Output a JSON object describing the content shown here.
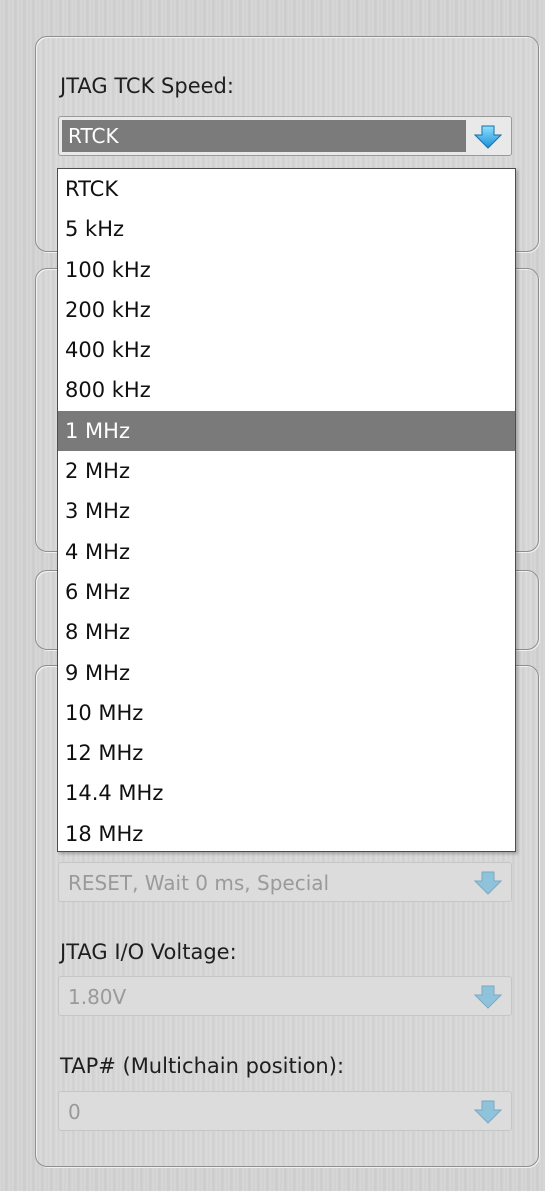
{
  "jtag_tck_speed": {
    "label": "JTAG TCK Speed:",
    "selected": "RTCK",
    "options": [
      "RTCK",
      "5 kHz",
      "100 kHz",
      "200 kHz",
      "400 kHz",
      "800 kHz",
      "1 MHz",
      "2 MHz",
      "3 MHz",
      "4 MHz",
      "6 MHz",
      "8 MHz",
      "9 MHz",
      "10 MHz",
      "12 MHz",
      "14.4 MHz",
      "18 MHz"
    ],
    "highlighted_option": "1 MHz"
  },
  "reset_mode": {
    "value": "RESET, Wait 0 ms, Special"
  },
  "jtag_io_voltage": {
    "label": "JTAG I/O Voltage:",
    "value": "1.80V"
  },
  "tap_position": {
    "label": "TAP# (Multichain position):",
    "value": "0"
  },
  "icons": {
    "dropdown_arrow": "chevron-down-icon"
  },
  "colors": {
    "arrow_active": "#2aa7e6",
    "arrow_disabled": "#8fc3dc",
    "highlight": "#7a7a7a"
  }
}
